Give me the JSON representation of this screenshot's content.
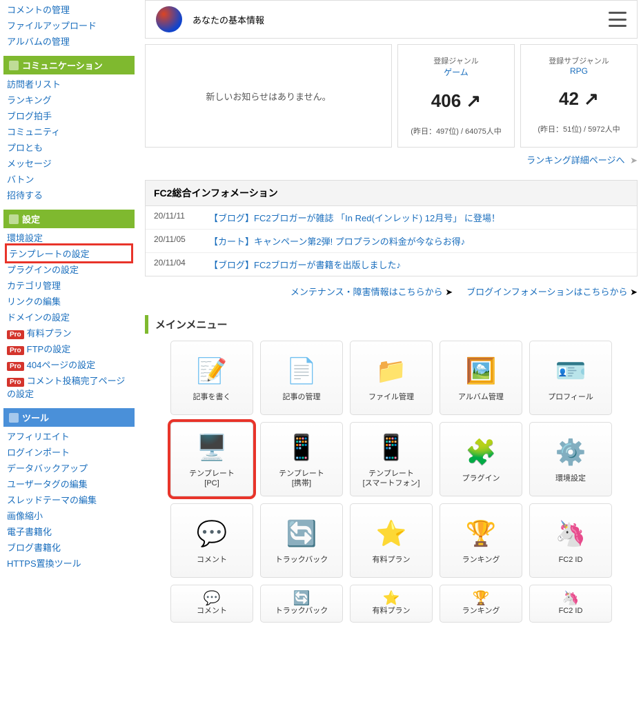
{
  "sidebar": {
    "top_links": [
      "コメントの管理",
      "ファイルアップロード",
      "アルバムの管理"
    ],
    "sections": [
      {
        "title": "コミュニケーション",
        "color": "green",
        "items": [
          {
            "label": "訪問者リスト",
            "pro": false,
            "highlight": false
          },
          {
            "label": "ランキング",
            "pro": false,
            "highlight": false
          },
          {
            "label": "ブログ拍手",
            "pro": false,
            "highlight": false
          },
          {
            "label": "コミュニティ",
            "pro": false,
            "highlight": false
          },
          {
            "label": "プロとも",
            "pro": false,
            "highlight": false
          },
          {
            "label": "メッセージ",
            "pro": false,
            "highlight": false
          },
          {
            "label": "バトン",
            "pro": false,
            "highlight": false
          },
          {
            "label": "招待する",
            "pro": false,
            "highlight": false
          }
        ]
      },
      {
        "title": "設定",
        "color": "green",
        "items": [
          {
            "label": "環境設定",
            "pro": false,
            "highlight": false
          },
          {
            "label": "テンプレートの設定",
            "pro": false,
            "highlight": true
          },
          {
            "label": "プラグインの設定",
            "pro": false,
            "highlight": false
          },
          {
            "label": "カテゴリ管理",
            "pro": false,
            "highlight": false
          },
          {
            "label": "リンクの編集",
            "pro": false,
            "highlight": false
          },
          {
            "label": "ドメインの設定",
            "pro": false,
            "highlight": false
          },
          {
            "label": "有料プラン",
            "pro": true,
            "highlight": false
          },
          {
            "label": "FTPの設定",
            "pro": true,
            "highlight": false
          },
          {
            "label": "404ページの設定",
            "pro": true,
            "highlight": false
          },
          {
            "label": "コメント投稿完了ページの設定",
            "pro": true,
            "highlight": false
          }
        ]
      },
      {
        "title": "ツール",
        "color": "blue",
        "items": [
          {
            "label": "アフィリエイト",
            "pro": false,
            "highlight": false
          },
          {
            "label": "ログインポート",
            "pro": false,
            "highlight": false
          },
          {
            "label": "データバックアップ",
            "pro": false,
            "highlight": false
          },
          {
            "label": "ユーザータグの編集",
            "pro": false,
            "highlight": false
          },
          {
            "label": "スレッドテーマの編集",
            "pro": false,
            "highlight": false
          },
          {
            "label": "画像縮小",
            "pro": false,
            "highlight": false
          },
          {
            "label": "電子書籍化",
            "pro": false,
            "highlight": false
          },
          {
            "label": "ブログ書籍化",
            "pro": false,
            "highlight": false
          },
          {
            "label": "HTTPS置換ツール",
            "pro": false,
            "highlight": false
          }
        ]
      }
    ],
    "pro_label": "Pro"
  },
  "profile": {
    "title": "あなたの基本情報"
  },
  "notice": {
    "empty_text": "新しいお知らせはありません。"
  },
  "stats": [
    {
      "label": "登録ジャンル",
      "category": "ゲーム",
      "value": "406 ↗",
      "footer": "(昨日：497位) / 64075人中"
    },
    {
      "label": "登録サブジャンル",
      "category": "RPG",
      "value": "42 ↗",
      "footer": "(昨日：51位) / 5972人中"
    }
  ],
  "ranking_link": "ランキング詳細ページへ",
  "info": {
    "header": "FC2総合インフォメーション",
    "rows": [
      {
        "date": "20/11/11",
        "title": "【ブログ】FC2ブロガーが雑誌 「In Red(インレッド) 12月号」 に登場！"
      },
      {
        "date": "20/11/05",
        "title": "【カート】キャンペーン第2弾! プロプランの料金が今ならお得♪"
      },
      {
        "date": "20/11/04",
        "title": "【ブログ】FC2ブロガーが書籍を出版しました♪"
      }
    ],
    "links": [
      "メンテナンス・障害情報はこちらから",
      "ブログインフォメーションはこちらから"
    ]
  },
  "main_menu": {
    "title": "メインメニュー",
    "items": [
      {
        "label": "記事を書く",
        "icon": "📝",
        "highlight": false
      },
      {
        "label": "記事の管理",
        "icon": "📄",
        "highlight": false
      },
      {
        "label": "ファイル管理",
        "icon": "📁",
        "highlight": false
      },
      {
        "label": "アルバム管理",
        "icon": "🖼️",
        "highlight": false
      },
      {
        "label": "プロフィール",
        "icon": "🪪",
        "highlight": false
      },
      {
        "label": "テンプレート\n[PC]",
        "icon": "🖥️",
        "highlight": true
      },
      {
        "label": "テンプレート\n[携帯]",
        "icon": "📱",
        "highlight": false
      },
      {
        "label": "テンプレート\n[スマートフォン]",
        "icon": "📱",
        "highlight": false
      },
      {
        "label": "プラグイン",
        "icon": "🧩",
        "highlight": false
      },
      {
        "label": "環境設定",
        "icon": "⚙️",
        "highlight": false
      },
      {
        "label": "コメント",
        "icon": "💬",
        "highlight": false
      },
      {
        "label": "トラックバック",
        "icon": "🔄",
        "highlight": false
      },
      {
        "label": "有料プラン",
        "icon": "⭐",
        "highlight": false
      },
      {
        "label": "ランキング",
        "icon": "🏆",
        "highlight": false
      },
      {
        "label": "FC2 ID",
        "icon": "🦄",
        "highlight": false
      }
    ],
    "items_short": [
      {
        "label": "コメント",
        "icon": "💬"
      },
      {
        "label": "トラックバック",
        "icon": "🔄"
      },
      {
        "label": "有料プラン",
        "icon": "⭐"
      },
      {
        "label": "ランキング",
        "icon": "🏆"
      },
      {
        "label": "FC2 ID",
        "icon": "🦄"
      }
    ]
  }
}
